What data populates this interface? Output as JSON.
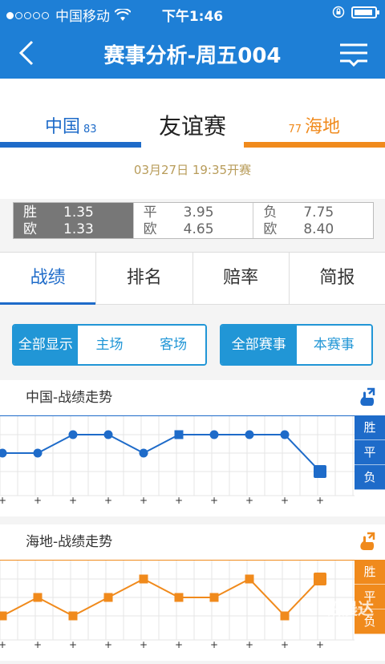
{
  "status_bar": {
    "carrier": "中国移动",
    "time": "下午1:46",
    "signal_dots": [
      true,
      false,
      false,
      false,
      false
    ]
  },
  "nav": {
    "title": "赛事分析-周五004"
  },
  "match": {
    "home_name": "中国",
    "home_rank": "83",
    "league": "友谊赛",
    "away_rank": "77",
    "away_name": "海地",
    "datetime": "03月27日  19:35开赛"
  },
  "odds": [
    {
      "rows": [
        {
          "k": "胜",
          "v": "1.35"
        },
        {
          "k": "欧",
          "v": "1.33"
        }
      ],
      "selected": true
    },
    {
      "rows": [
        {
          "k": "平",
          "v": "3.95"
        },
        {
          "k": "欧",
          "v": "4.65"
        }
      ],
      "selected": false
    },
    {
      "rows": [
        {
          "k": "负",
          "v": "7.75"
        },
        {
          "k": "欧",
          "v": "8.40"
        }
      ],
      "selected": false
    }
  ],
  "tabs": [
    "战绩",
    "排名",
    "赔率",
    "简报"
  ],
  "filters1": [
    "全部显示",
    "主场",
    "客场"
  ],
  "filters2": [
    "全部赛事",
    "本赛事"
  ],
  "trend_home": {
    "title": "中国-战绩走势",
    "color": "#1e6bc9",
    "legend": [
      "胜",
      "平",
      "负"
    ],
    "results": [
      "平",
      "平",
      "胜",
      "胜",
      "平",
      "胜",
      "胜",
      "胜",
      "胜",
      "负"
    ]
  },
  "trend_away": {
    "title": "海地-战绩走势",
    "color": "#f08a1c",
    "legend": [
      "胜",
      "平",
      "负"
    ],
    "results": [
      "负",
      "平",
      "负",
      "平",
      "胜",
      "平",
      "平",
      "胜",
      "负",
      "胜"
    ]
  },
  "watermark": "铅晨达"
}
